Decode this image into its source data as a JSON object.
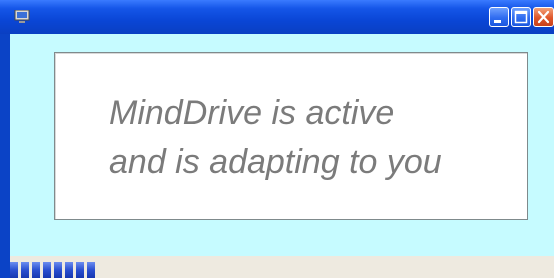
{
  "window": {
    "app_icon": "computer-icon",
    "controls": [
      {
        "name": "minimize-icon"
      },
      {
        "name": "maximize-icon"
      },
      {
        "name": "close-icon"
      }
    ]
  },
  "message": {
    "line1": "MindDrive is active",
    "line2": "and is adapting to you"
  },
  "progress": {
    "fraction": 0.16
  },
  "colors": {
    "title_bar": "#0a46d6",
    "client_background": "#c6fbff",
    "message_text": "#7b7b7b",
    "progress_fill": "#2a4fd0"
  }
}
